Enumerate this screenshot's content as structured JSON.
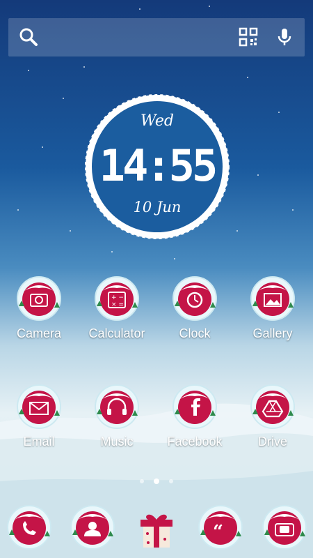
{
  "search": {
    "search_icon": "search-icon",
    "qr_icon": "qr-code-icon",
    "mic_icon": "microphone-icon"
  },
  "clock": {
    "day": "Wed",
    "time": "14:55",
    "date": "10 Jun"
  },
  "apps": [
    {
      "label": "Camera",
      "icon": "camera-icon"
    },
    {
      "label": "Calculator",
      "icon": "calculator-icon"
    },
    {
      "label": "Clock",
      "icon": "clock-icon"
    },
    {
      "label": "Gallery",
      "icon": "gallery-icon"
    },
    {
      "label": "Email",
      "icon": "email-icon"
    },
    {
      "label": "Music",
      "icon": "headphones-icon"
    },
    {
      "label": "Facebook",
      "icon": "facebook-icon"
    },
    {
      "label": "Drive",
      "icon": "drive-icon"
    }
  ],
  "pager": {
    "pages": 3,
    "active": 2
  },
  "dock": [
    {
      "icon": "phone-icon"
    },
    {
      "icon": "contacts-icon"
    },
    {
      "icon": "gift-icon"
    },
    {
      "icon": "messages-icon"
    },
    {
      "icon": "photo-camera-icon"
    }
  ],
  "colors": {
    "globe_red": "#c41447",
    "glass": "#e9f7fb",
    "snow": "#ffffff",
    "tree": "#2f8a4c"
  }
}
